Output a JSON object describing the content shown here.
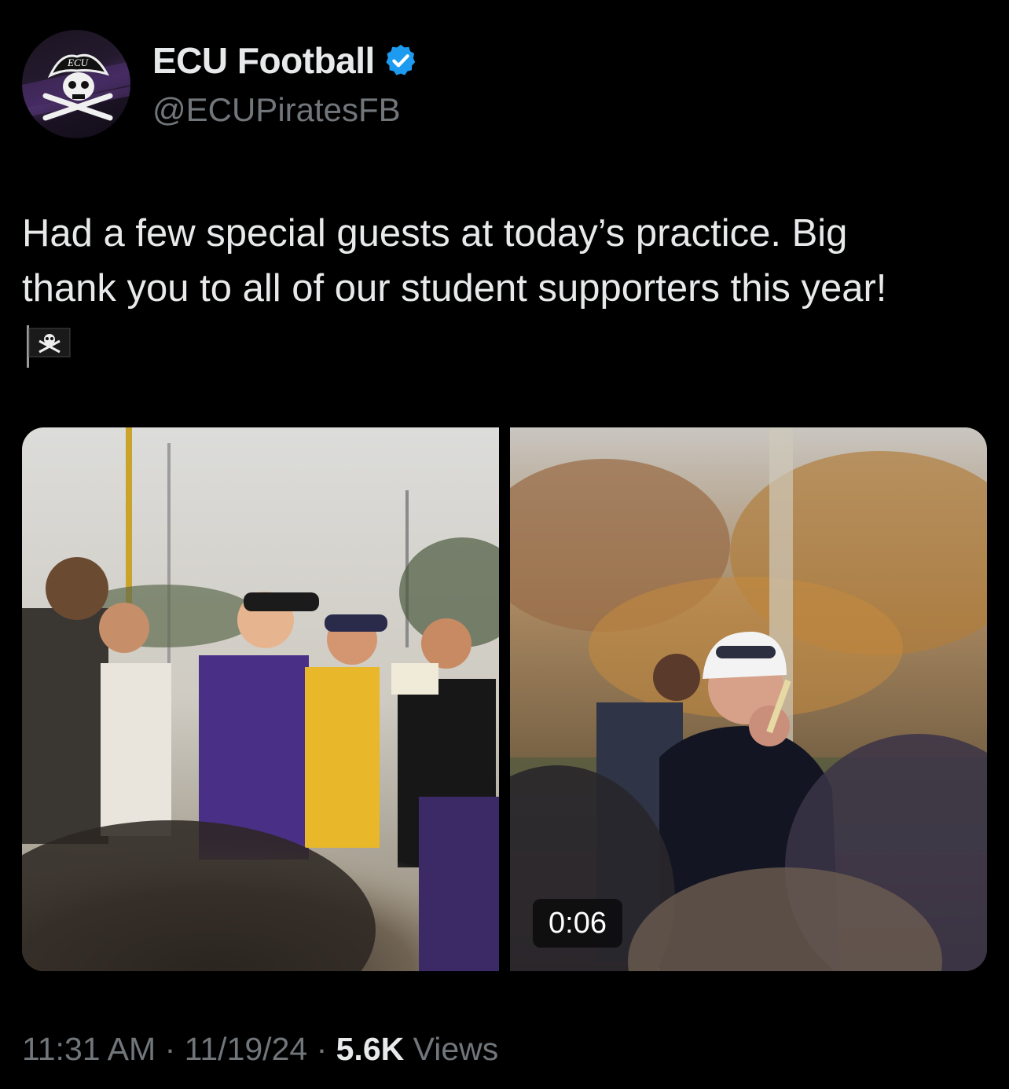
{
  "account": {
    "display_name": "ECU Football",
    "handle": "@ECUPiratesFB",
    "verified": true,
    "avatar_logo_text": "ECU",
    "verified_color": "#1d9bf0"
  },
  "tweet": {
    "text_line1": "Had a few special guests at today’s practice. Big",
    "text_line2": "thank you to all of our student supporters this year!",
    "emoji": "pirate-flag-icon"
  },
  "media": {
    "left_photo": "students-at-practice-photo",
    "right_photo": "coach-video-thumbnail",
    "video_duration": "0:06"
  },
  "meta": {
    "time": "11:31 AM",
    "sep1": " · ",
    "date": "11/19/24",
    "sep2": " · ",
    "views_count": "5.6K",
    "views_label": " Views"
  }
}
